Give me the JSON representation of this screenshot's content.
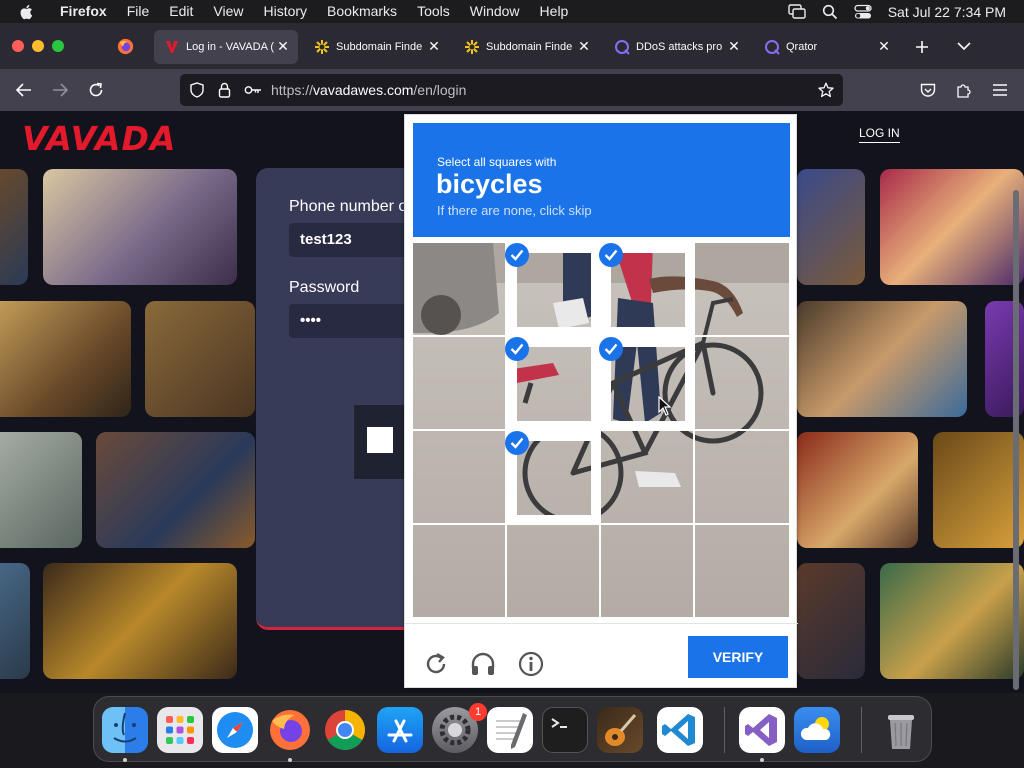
{
  "menubar": {
    "app": "Firefox",
    "items": [
      "File",
      "Edit",
      "View",
      "History",
      "Bookmarks",
      "Tools",
      "Window",
      "Help"
    ],
    "clock": "Sat Jul 22  7:34 PM"
  },
  "tabs": [
    {
      "label": "Log in - VAVADA (",
      "active": true
    },
    {
      "label": "Subdomain Finde",
      "active": false
    },
    {
      "label": "Subdomain Finde",
      "active": false
    },
    {
      "label": "DDoS attacks pro",
      "active": false
    },
    {
      "label": "Qrator",
      "active": false
    }
  ],
  "address": {
    "prefix": "https://",
    "domain": "vavadawes.com",
    "path": "/en/login"
  },
  "site": {
    "logo": "VAVADA",
    "login_link": "LOG IN",
    "phone_label": "Phone number o",
    "phone_value": "test123",
    "password_label": "Password",
    "password_value": "••••"
  },
  "captcha": {
    "instruction": "Select all squares with",
    "target": "bicycles",
    "hint": "If there are none, click skip",
    "verify_label": "VERIFY",
    "selected_cells": [
      1,
      2,
      5,
      6,
      9
    ]
  },
  "dock": {
    "badge_count": "1"
  }
}
